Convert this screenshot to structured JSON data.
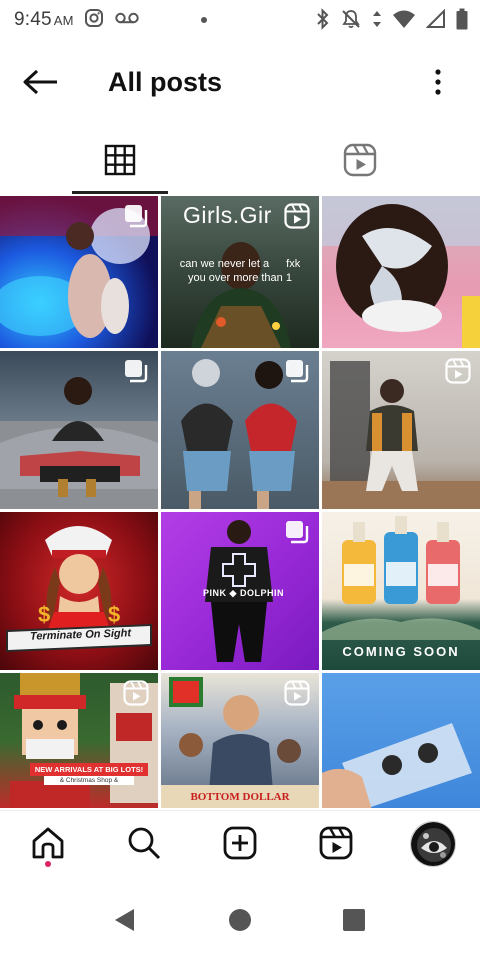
{
  "status_bar": {
    "time": "9:45",
    "ampm": "AM",
    "icons": [
      "instagram-icon",
      "voicemail-icon",
      "bluetooth-icon",
      "mute-icon",
      "wifi-icon",
      "signal-icon",
      "battery-icon"
    ]
  },
  "header": {
    "title": "All posts",
    "back_icon": "arrow-left-icon",
    "more_icon": "more-vertical-icon"
  },
  "tabs": [
    {
      "name": "posts-grid",
      "icon": "grid-icon",
      "selected": true
    },
    {
      "name": "reels",
      "icon": "reels-icon",
      "selected": false
    }
  ],
  "posts": [
    {
      "badge": "carousel"
    },
    {
      "badge": "reel",
      "text_1": "Girls.Gir",
      "text_2": "can we never let a",
      "text_3": "fxk",
      "text_4": "you over more than 1"
    },
    {
      "badge": ""
    },
    {
      "badge": "carousel"
    },
    {
      "badge": "carousel"
    },
    {
      "badge": "reel"
    },
    {
      "badge": "",
      "text_1": "Terminate On Sight"
    },
    {
      "badge": "carousel",
      "text_1": "PINK",
      "text_2": "DOLPHIN"
    },
    {
      "badge": "",
      "text_1": "COMING SOON"
    },
    {
      "badge": "reel",
      "text_1": "NEW ARRIVALS AT BIG LOTS!",
      "text_2": "& Christmas Shop &"
    },
    {
      "badge": "reel",
      "text_1": "BOTTOM DOLLAR"
    },
    {
      "badge": ""
    }
  ],
  "bottom_nav": [
    {
      "name": "home",
      "icon": "home-icon",
      "active": true
    },
    {
      "name": "search",
      "icon": "search-icon",
      "active": false
    },
    {
      "name": "create",
      "icon": "plus-square-icon",
      "active": false
    },
    {
      "name": "reels",
      "icon": "reels-icon",
      "active": false
    },
    {
      "name": "profile",
      "icon": "avatar",
      "active": false
    }
  ],
  "colors": {
    "text": "#111111",
    "notification_dot": "#e0245e",
    "tab_underline": "#222222"
  },
  "system_nav": [
    "back-triangle-icon",
    "home-circle-icon",
    "recents-square-icon"
  ]
}
